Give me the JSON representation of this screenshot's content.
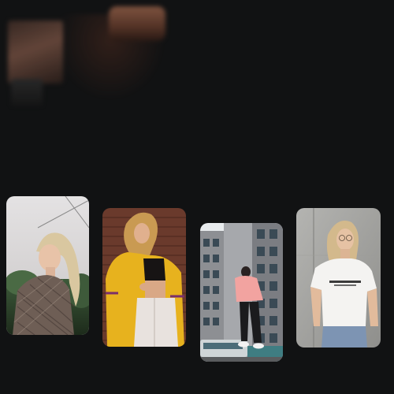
{
  "gallery": {
    "hero_preview": {
      "icon": "blurred-photo-preview"
    },
    "cards": [
      {
        "id": "card-1",
        "subject": "blonde-woman-plaid-coat-photo"
      },
      {
        "id": "card-2",
        "subject": "woman-yellow-jacket-photo"
      },
      {
        "id": "card-3",
        "subject": "person-pink-hoodie-building-photo"
      },
      {
        "id": "card-4",
        "subject": "woman-white-tshirt-photo"
      }
    ]
  },
  "colors": {
    "background": "#111213",
    "card_radius_tone": "#ffffff"
  }
}
